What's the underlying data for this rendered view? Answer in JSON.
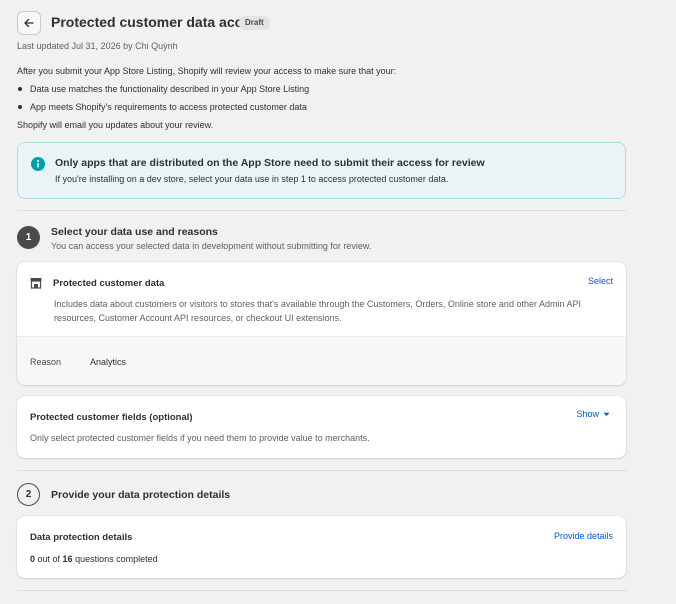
{
  "header": {
    "title": "Protected customer data access",
    "badge": "Draft",
    "updated": "Last updated Jul 31, 2026 by Chi Quỳnh"
  },
  "intro": {
    "lead": "After you submit your App Store Listing, Shopify will review your access to make sure that your:",
    "bullets": [
      "Data use matches the functionality described in your App Store Listing",
      "App meets Shopify's requirements to access protected customer data"
    ],
    "email_note": "Shopify will email you updates about your review."
  },
  "banner": {
    "title": "Only apps that are distributed on the App Store need to submit their access for review",
    "subtitle": "If you're installing on a dev store, select your data use in step 1 to access protected customer data."
  },
  "step1": {
    "number": "1",
    "title": "Select your data use and reasons",
    "subtitle": "You can access your selected data in development without submitting for review.",
    "data_card": {
      "title": "Protected customer data",
      "action": "Select",
      "description_line1": "Includes data about customers or visitors to stores that's available through the Customers, Orders, Online store and other Admin API",
      "description_line2": "resources, Customer Account API resources, or checkout UI extensions.",
      "reason_label": "Reason",
      "reason_value": "Analytics"
    },
    "fields_card": {
      "title": "Protected customer fields (optional)",
      "action": "Show",
      "description": "Only select protected customer fields if you need them to provide value to merchants."
    }
  },
  "step2": {
    "number": "2",
    "title": "Provide your data protection details",
    "card": {
      "title": "Data protection details",
      "action": "Provide details",
      "completed": "0",
      "out_of_text": " out of ",
      "total": "16",
      "suffix": " questions completed"
    }
  },
  "colors": {
    "accent_link": "#005bd3",
    "banner_bg": "#eaf4f6",
    "banner_border": "#a8dde6",
    "info_icon": "#00a0ac"
  },
  "icons": {
    "back": "arrow-left-icon",
    "info": "info-circle-icon",
    "store": "store-icon",
    "chevron": "caret-down-icon"
  }
}
